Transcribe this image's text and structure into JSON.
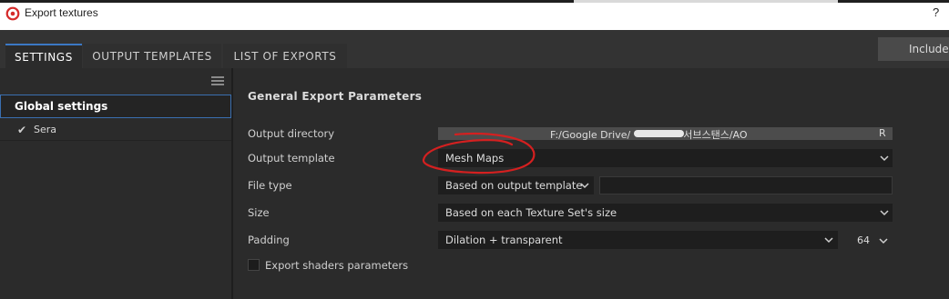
{
  "window": {
    "title": "Export textures",
    "help_label": "?"
  },
  "tabs": [
    {
      "label": "SETTINGS",
      "active": true
    },
    {
      "label": "OUTPUT TEMPLATES",
      "active": false
    },
    {
      "label": "LIST OF EXPORTS",
      "active": false
    }
  ],
  "include_button": "Include",
  "sidebar": {
    "global_label": "Global settings",
    "items": [
      {
        "label": "Sera",
        "checked": true
      }
    ]
  },
  "main": {
    "section_title": "General Export Parameters",
    "output_directory": {
      "label": "Output directory",
      "value": "F:/Google Drive/서브스탠스/AO",
      "path_prefix": "F:/Google Drive/",
      "path_suffix": "서브스탠스/AO",
      "reveal_button": "R"
    },
    "output_template": {
      "label": "Output template",
      "value": "Mesh Maps"
    },
    "file_type": {
      "label": "File type",
      "value": "Based on output template",
      "extra_value": ""
    },
    "size": {
      "label": "Size",
      "value": "Based on each Texture Set's size"
    },
    "padding": {
      "label": "Padding",
      "value": "Dilation + transparent",
      "amount": "64"
    },
    "export_shaders": {
      "label": "Export shaders parameters",
      "checked": false
    }
  },
  "colors": {
    "accent": "#3b78c4",
    "annotation": "#d42020",
    "background": "#2b2b2b",
    "field_background": "#1e1e1e"
  }
}
